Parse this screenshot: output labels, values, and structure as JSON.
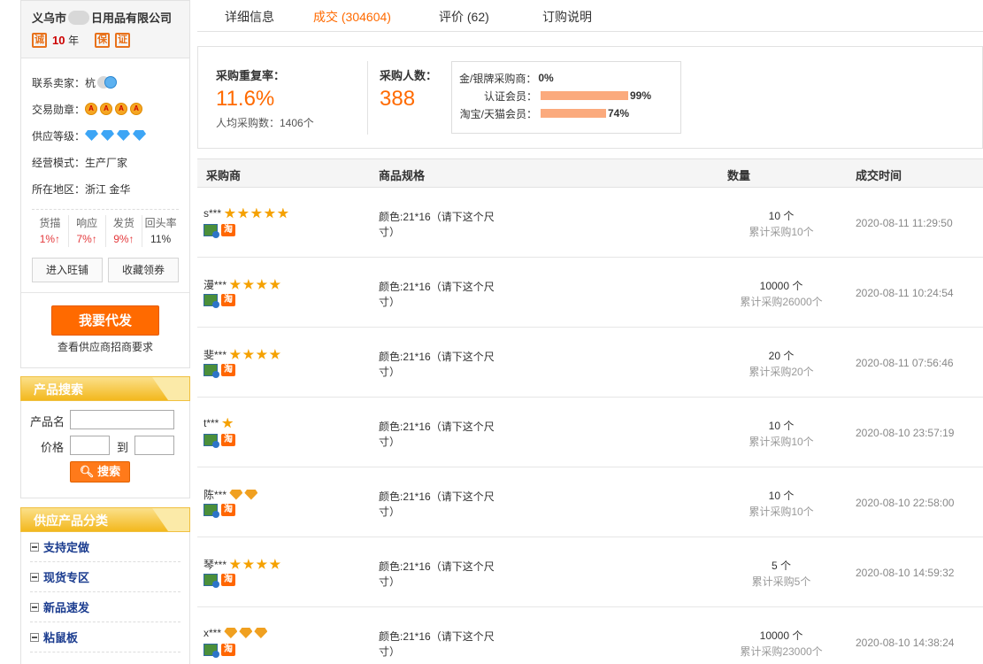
{
  "company": {
    "name_pre": "义乌市",
    "name_post": "日用品有限公司",
    "cheng": "诚",
    "years": "10",
    "years_unit": "年",
    "badge1": "保",
    "badge2": "证"
  },
  "seller": {
    "contact_label": "联系卖家：",
    "contact_value": "杭",
    "medal_label": "交易勋章：",
    "level_label": "供应等级：",
    "mode_label": "经营模式：",
    "mode_value": "生产厂家",
    "region_label": "所在地区：",
    "region_value": "浙江 金华"
  },
  "stats": [
    {
      "label": "货描",
      "value": "1%↑"
    },
    {
      "label": "响应",
      "value": "7%↑"
    },
    {
      "label": "发货",
      "value": "9%↑"
    },
    {
      "label": "回头率",
      "value": "11%"
    }
  ],
  "buttons": {
    "enter_shop": "进入旺铺",
    "collect": "收藏领券",
    "daifa": "我要代发",
    "daifa_sub": "查看供应商招商要求"
  },
  "search": {
    "title": "产品搜索",
    "name_label": "产品名",
    "price_label": "价格",
    "to_label": "到",
    "search_button": "搜索"
  },
  "category": {
    "title": "供应产品分类",
    "items": [
      "支持定做",
      "现货专区",
      "新品速发",
      "粘鼠板"
    ]
  },
  "tabs": [
    "详细信息",
    "成交 (304604)",
    "评价 (62)",
    "订购说明"
  ],
  "summary": {
    "repeat_label": "采购重复率：",
    "repeat_value": "11.6%",
    "avg_text": "人均采购数：1406个",
    "buyers_label": "采购人数：",
    "buyers_value": "388",
    "members": [
      {
        "label": "金/银牌采购商：",
        "value": "0%",
        "pct": 0
      },
      {
        "label": "认证会员：",
        "value": "99%",
        "pct": 99
      },
      {
        "label": "淘宝/天猫会员：",
        "value": "74%",
        "pct": 74
      }
    ]
  },
  "table": {
    "headers": [
      "采购商",
      "商品规格",
      "数量",
      "成交时间"
    ],
    "rows": [
      {
        "buyer": "s***",
        "stars": 5,
        "diamonds": 0,
        "spec": "颜色:21*16（请下这个尺寸）",
        "qty": "10 个",
        "cum": "累计采购10个",
        "time": "2020-08-11 11:29:50"
      },
      {
        "buyer": "漫***",
        "stars": 4,
        "diamonds": 0,
        "spec": "颜色:21*16（请下这个尺寸）",
        "qty": "10000 个",
        "cum": "累计采购26000个",
        "time": "2020-08-11 10:24:54"
      },
      {
        "buyer": "斐***",
        "stars": 4,
        "diamonds": 0,
        "spec": "颜色:21*16（请下这个尺寸）",
        "qty": "20 个",
        "cum": "累计采购20个",
        "time": "2020-08-11 07:56:46"
      },
      {
        "buyer": "t***",
        "stars": 1,
        "diamonds": 0,
        "spec": "颜色:21*16（请下这个尺寸）",
        "qty": "10 个",
        "cum": "累计采购10个",
        "time": "2020-08-10 23:57:19"
      },
      {
        "buyer": "陈***",
        "stars": 0,
        "diamonds": 2,
        "spec": "颜色:21*16（请下这个尺寸）",
        "qty": "10 个",
        "cum": "累计采购10个",
        "time": "2020-08-10 22:58:00"
      },
      {
        "buyer": "琴***",
        "stars": 4,
        "diamonds": 0,
        "spec": "颜色:21*16（请下这个尺寸）",
        "qty": "5 个",
        "cum": "累计采购5个",
        "time": "2020-08-10 14:59:32"
      },
      {
        "buyer": "x***",
        "stars": 0,
        "diamonds": 3,
        "spec": "颜色:21*16（请下这个尺寸）",
        "qty": "10000 个",
        "cum": "累计采购23000个",
        "time": "2020-08-10 14:38:24"
      }
    ]
  }
}
